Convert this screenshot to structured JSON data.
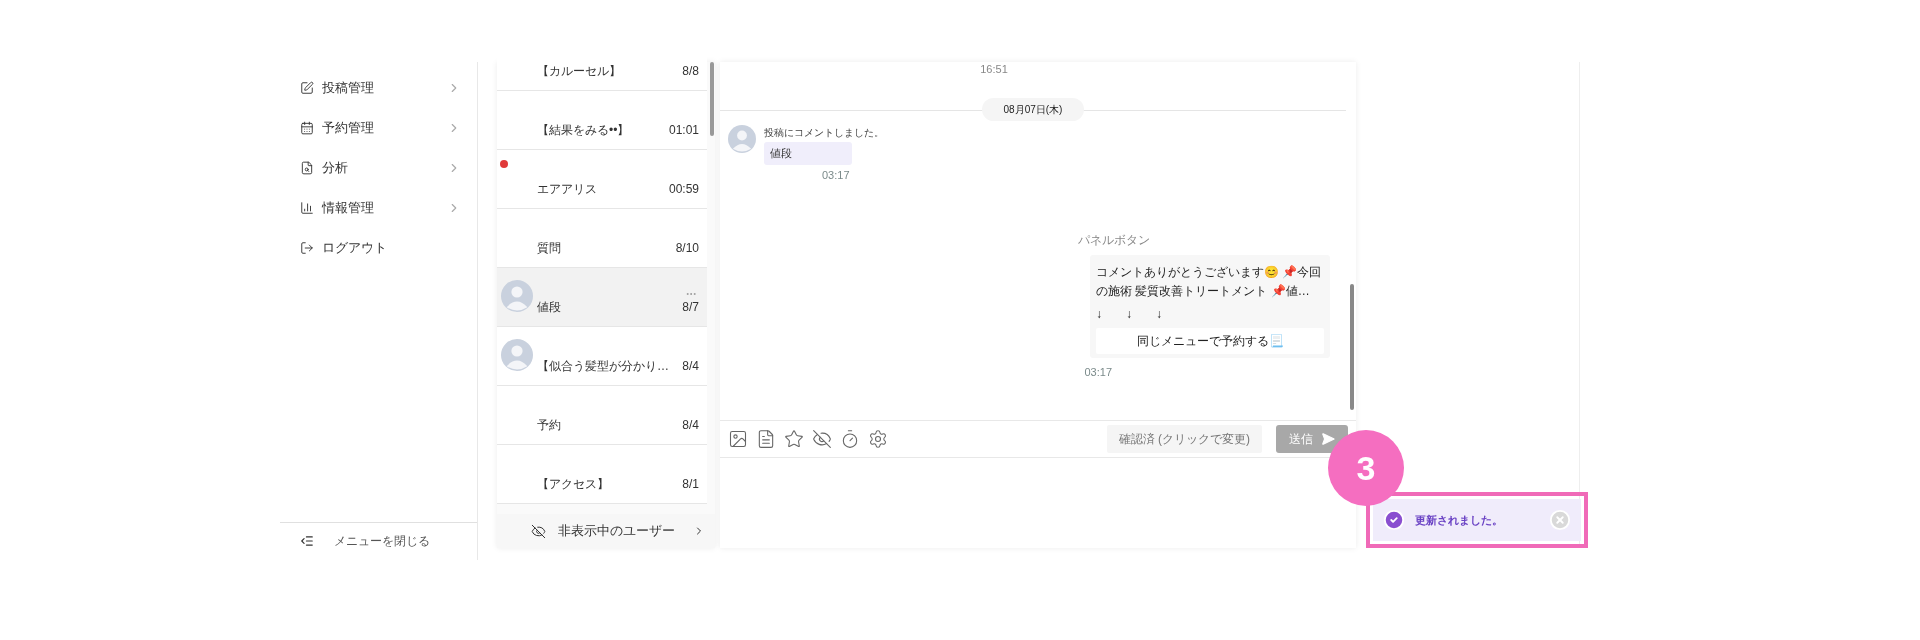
{
  "sidebar": {
    "items": [
      {
        "label": "投稿管理",
        "chevron": true
      },
      {
        "label": "予約管理",
        "chevron": true
      },
      {
        "label": "分析",
        "chevron": true
      },
      {
        "label": "情報管理",
        "chevron": true
      },
      {
        "label": "ログアウト",
        "chevron": false
      }
    ],
    "footer": "メニューを閉じる"
  },
  "conversations": {
    "items": [
      {
        "name": "【カルーセル】",
        "time": "8/8",
        "avatar": false,
        "unread": false,
        "selected": false
      },
      {
        "name": "【結果をみる••】",
        "time": "01:01",
        "avatar": false,
        "unread": false,
        "selected": false
      },
      {
        "name": "エアアリス",
        "time": "00:59",
        "avatar": false,
        "unread": true,
        "selected": false
      },
      {
        "name": "質問",
        "time": "8/10",
        "avatar": false,
        "unread": false,
        "selected": false
      },
      {
        "name": "値段",
        "time": "8/7",
        "avatar": true,
        "unread": false,
        "selected": true
      },
      {
        "name": "【似合う髪型が分かり…",
        "time": "8/4",
        "avatar": true,
        "unread": false,
        "selected": false
      },
      {
        "name": "予約",
        "time": "8/4",
        "avatar": false,
        "unread": false,
        "selected": false
      },
      {
        "name": "【アクセス】",
        "time": "8/1",
        "avatar": false,
        "unread": false,
        "selected": false
      }
    ],
    "hidden_users": "非表示中のユーザー"
  },
  "chat": {
    "top_time": "16:51",
    "date": "08月07日(木)",
    "messages": [
      {
        "kind": "incoming",
        "note": "投稿にコメントしました。",
        "text": "値段",
        "time": "03:17"
      },
      {
        "kind": "panel",
        "title": "パネルボタン",
        "lines": [
          "コメントありがとうございます😊 📌今回の施術 髪質改善トリートメント 📌値…",
          "↓　　↓　　↓"
        ],
        "button": "同じメニューで予約する📃",
        "time": "03:17"
      }
    ],
    "toolbar": {
      "status_button": "確認済 (クリックで変更)",
      "send_button": "送信",
      "send_disabled": true
    }
  },
  "toast": {
    "message": "更新されました。",
    "step": "3"
  }
}
